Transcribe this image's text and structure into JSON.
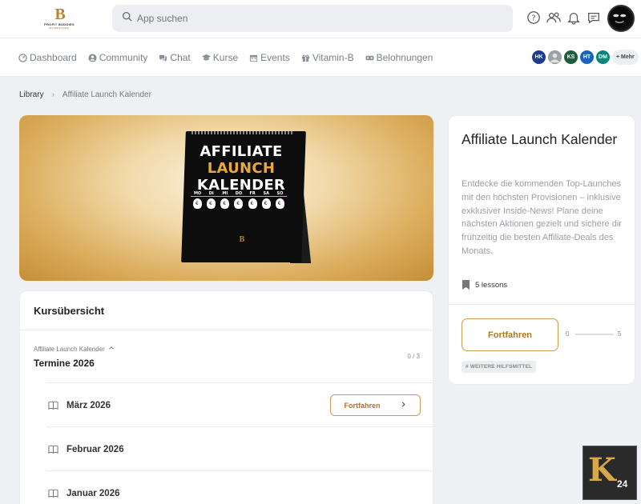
{
  "brand": {
    "logo_mark": "B",
    "logo_word": "PROFIT BUDDIES",
    "logo_sub": "MARKETING"
  },
  "search": {
    "placeholder": "App suchen"
  },
  "nav": {
    "items": [
      {
        "label": "Dashboard",
        "icon": "dashboard-icon"
      },
      {
        "label": "Community",
        "icon": "community-icon"
      },
      {
        "label": "Chat",
        "icon": "chat-icon"
      },
      {
        "label": "Kurse",
        "icon": "courses-icon"
      },
      {
        "label": "Events",
        "icon": "calendar-icon"
      },
      {
        "label": "Vitamin-B",
        "icon": "gift-icon"
      },
      {
        "label": "Belohnungen",
        "icon": "rewards-icon"
      }
    ],
    "members": [
      {
        "initials": "HK",
        "color": "#1f3a93"
      },
      {
        "initials": "",
        "color": "#8a8f99"
      },
      {
        "initials": "KS",
        "color": "#1b5e3b"
      },
      {
        "initials": "HT",
        "color": "#1565c0"
      },
      {
        "initials": "DM",
        "color": "#00897b"
      }
    ],
    "more_label": "+ Mehr"
  },
  "breadcrumb": {
    "root": "Library",
    "current": "Affiliate Launch Kalender"
  },
  "hero": {
    "title_line1": "AFFILIATE",
    "title_line2": "LAUNCH",
    "title_line3": "KALENDER",
    "days": [
      "MO",
      "DI",
      "MI",
      "DO",
      "FR",
      "SA",
      "SO"
    ],
    "logo": "B"
  },
  "course": {
    "heading": "Kursübersicht",
    "section_label": "Affiliate Launch Kalender",
    "section_title": "Termine 2026",
    "progress": "0 / 3",
    "lessons": [
      {
        "title": "März 2026",
        "button": "Fortfahren"
      },
      {
        "title": "Februar 2026"
      },
      {
        "title": "Januar 2026"
      }
    ]
  },
  "info": {
    "title": "Affiliate Launch Kalender",
    "description": "Entdecke die kommenden Top-Launches mit den höchsten Provisionen – inklusive exklusiver Inside-News! Plane deine nächsten Aktionen gezielt und sichere dir frühzeitig die besten Affiliate-Deals des Monats.",
    "lessons_count": "5 lessons",
    "cta": "Fortfahren",
    "progress_min": "0",
    "progress_max": "5",
    "progress_fraction": 0,
    "tag": "# WEITERE HILFSMITTEL"
  },
  "badge": {
    "letters": "K",
    "number": "24"
  },
  "colors": {
    "accent": "#b0771f",
    "accent_border": "#c89a52"
  }
}
